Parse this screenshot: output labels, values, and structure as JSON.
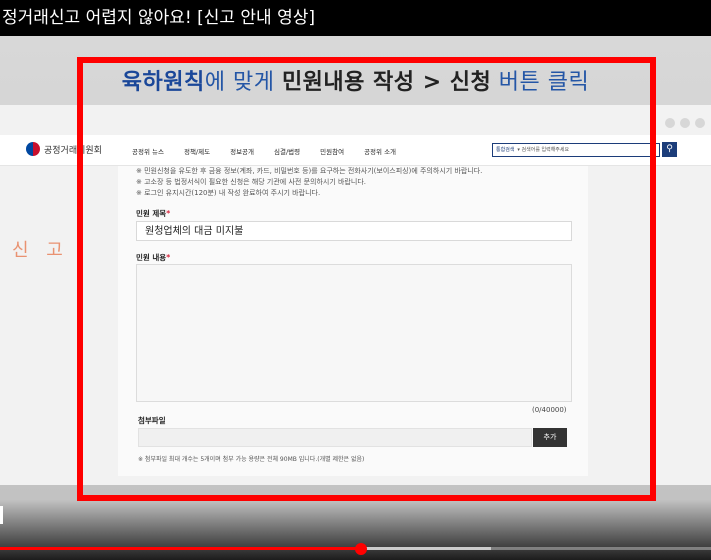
{
  "video": {
    "title": "정거래신고 어렵지 않아요! [신고 안내 영상]",
    "progress_fraction": 0.508,
    "buffered_fraction": 0.69
  },
  "banner": {
    "part1": "육하원칙",
    "part2": "에 맞게 ",
    "part3": "민원내용 작성 > 신청",
    "part4": " 버튼 클릭"
  },
  "background": {
    "left_text": "신 고"
  },
  "site": {
    "logo_text": "공정거래위원회",
    "nav": [
      "공정위 뉴스",
      "정책/제도",
      "정보공개",
      "심결/법령",
      "민원참여",
      "공정위 소개"
    ],
    "search_scope": "통합검색",
    "search_placeholder": "검색어를 입력해주세요"
  },
  "form": {
    "notices": [
      "※ 민원신청을 유도한 후 금융 정보(계좌, 카드, 비밀번호 등)를 요구하는 전화사기(보이스피싱)에 주의하시기 바랍니다.",
      "※ 고소장 등 법정서식이 필요한 신청은 해당 기관에 사전 문의하시기 바랍니다.",
      "※ 로그인 유지시간(120분) 내 작성 완료하여 주시기 바랍니다."
    ],
    "subject_label": "민원 제목",
    "subject_value": "원청업체의 대금 미지불",
    "content_label": "민원 내용",
    "char_count": "(0/40000)",
    "attach_label": "첨부파일",
    "add_button": "추가",
    "attach_notice": "※ 첨부파일 최대 개수는 5개이며 첨부 가능 용량은 전체 90MB 입니다.(개별 제한은 없음)",
    "required_mark": "*"
  },
  "colors": {
    "highlight_frame": "#ff0000",
    "banner_blue": "#2456a6",
    "progress_red": "#ff0000"
  }
}
